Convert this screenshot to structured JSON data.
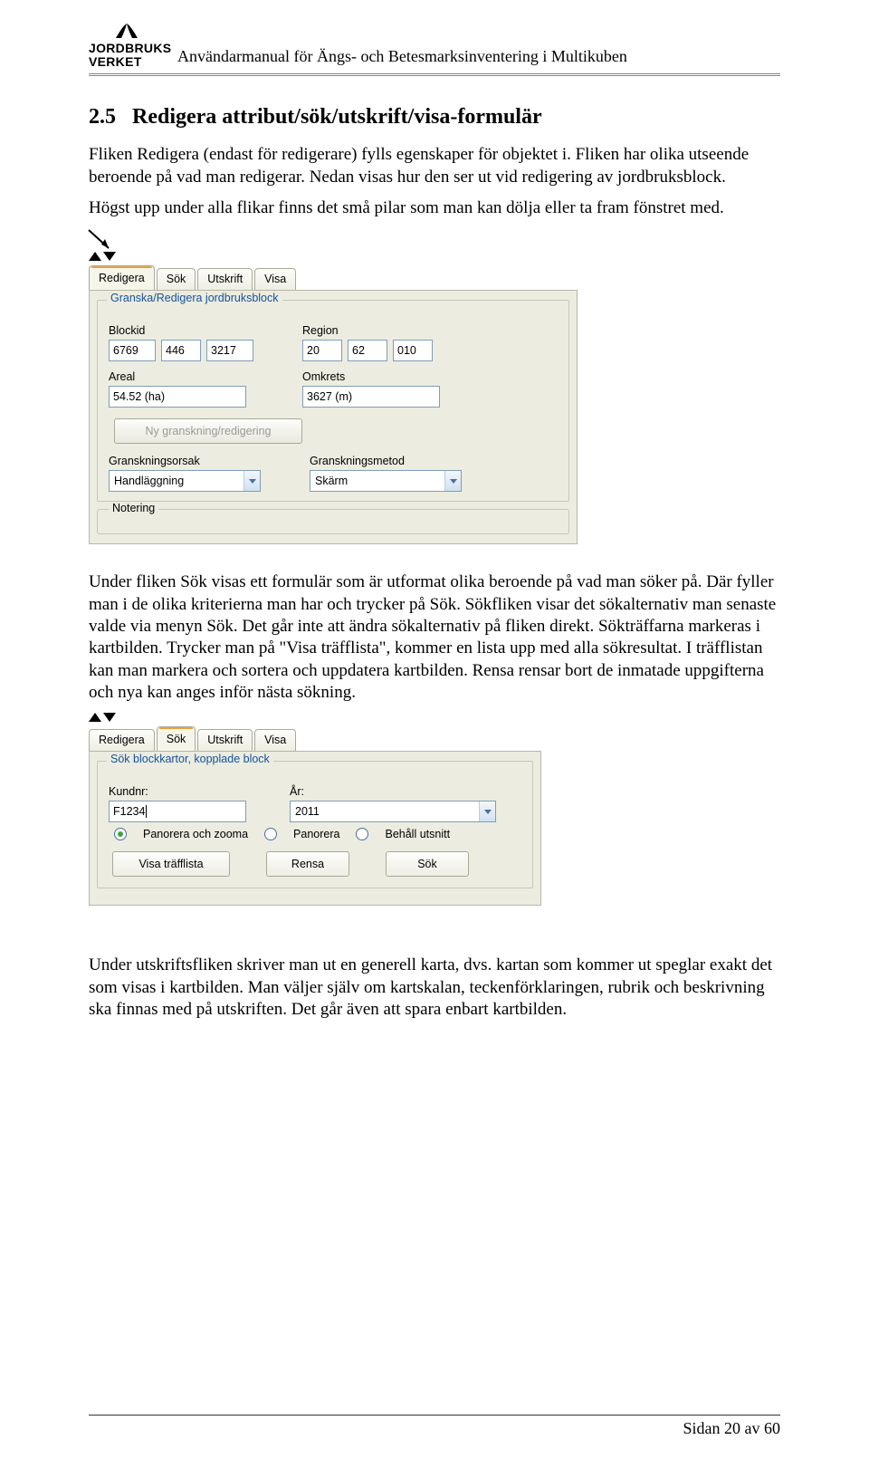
{
  "header": {
    "logo_line1": "JORDBRUKS",
    "logo_line2": "VERKET",
    "title": "Användarmanual för Ängs- och Betesmarksinventering i Multikuben"
  },
  "section": {
    "number": "2.5",
    "title": "Redigera attribut/sök/utskrift/visa-formulär"
  },
  "para1": "Fliken Redigera (endast för redigerare) fylls egenskaper för objektet i. Fliken har olika utseende beroende på vad man redigerar. Nedan visas hur den ser ut vid redigering av jordbruksblock.",
  "para2": "Högst upp under alla flikar finns det små pilar som man kan dölja eller ta fram fönstret med.",
  "screenshot1": {
    "tabs": [
      "Redigera",
      "Sök",
      "Utskrift",
      "Visa"
    ],
    "active_tab": 0,
    "group_title": "Granska/Redigera jordbruksblock",
    "labels": {
      "blockid": "Blockid",
      "region": "Region",
      "areal": "Areal",
      "omkrets": "Omkrets",
      "granskningsorsak": "Granskningsorsak",
      "granskningsmetod": "Granskningsmetod",
      "notering": "Notering"
    },
    "values": {
      "blockid": [
        "6769",
        "446",
        "3217"
      ],
      "region": [
        "20",
        "62",
        "010"
      ],
      "areal": "54.52 (ha)",
      "omkrets": "3627 (m)",
      "granskningsorsak": "Handläggning",
      "granskningsmetod": "Skärm"
    },
    "button_new": "Ny granskning/redigering"
  },
  "para3": "Under fliken Sök visas ett formulär som är utformat olika beroende på vad man söker på. Där fyller man i de olika kriterierna man har och trycker på Sök. Sökfliken visar det sökalternativ man senaste valde via menyn Sök. Det går inte att ändra sökalternativ på fliken direkt. Sökträffarna markeras i kartbilden. Trycker man på \"Visa träfflista\", kommer en lista upp med alla sökresultat. I träfflistan kan man markera och sortera och uppdatera kartbilden. Rensa rensar bort de inmatade uppgifterna och nya kan anges inför nästa sökning.",
  "screenshot2": {
    "tabs": [
      "Redigera",
      "Sök",
      "Utskrift",
      "Visa"
    ],
    "active_tab": 1,
    "group_title": "Sök blockkartor, kopplade block",
    "labels": {
      "kundnr": "Kundnr:",
      "ar": "År:"
    },
    "values": {
      "kundnr": "F1234",
      "ar": "2011"
    },
    "radios": [
      "Panorera och zooma",
      "Panorera",
      "Behåll utsnitt"
    ],
    "radio_selected": 0,
    "buttons": [
      "Visa träfflista",
      "Rensa",
      "Sök"
    ]
  },
  "para4": "Under utskriftsfliken skriver man ut en generell karta, dvs. kartan som kommer ut speglar exakt det som visas i kartbilden. Man väljer själv om kartskalan, teckenförklaringen, rubrik och beskrivning ska finnas med på utskriften. Det går även att spara enbart kartbilden.",
  "footer": "Sidan 20 av 60"
}
